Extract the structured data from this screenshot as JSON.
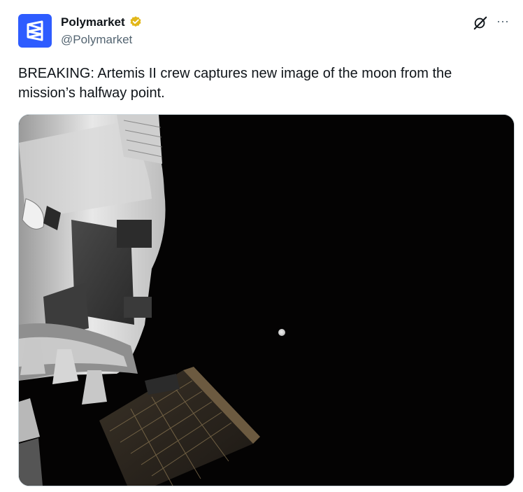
{
  "author": {
    "name": "Polymarket",
    "handle": "@Polymarket",
    "verified": true,
    "badge_color": "#e2b719",
    "avatar_color": "#2e5cff",
    "avatar_icon": "polymarket-logo"
  },
  "actions": {
    "grok_icon": "grok-icon",
    "more_icon": "more-icon",
    "more_glyph": "···"
  },
  "tweet": {
    "text_line1": "BREAKING: Artemis II crew captures new image of the moon from the",
    "text_line2": "mission’s halfway point."
  },
  "media": {
    "description_icon": "photo",
    "background_color": "#040303"
  }
}
